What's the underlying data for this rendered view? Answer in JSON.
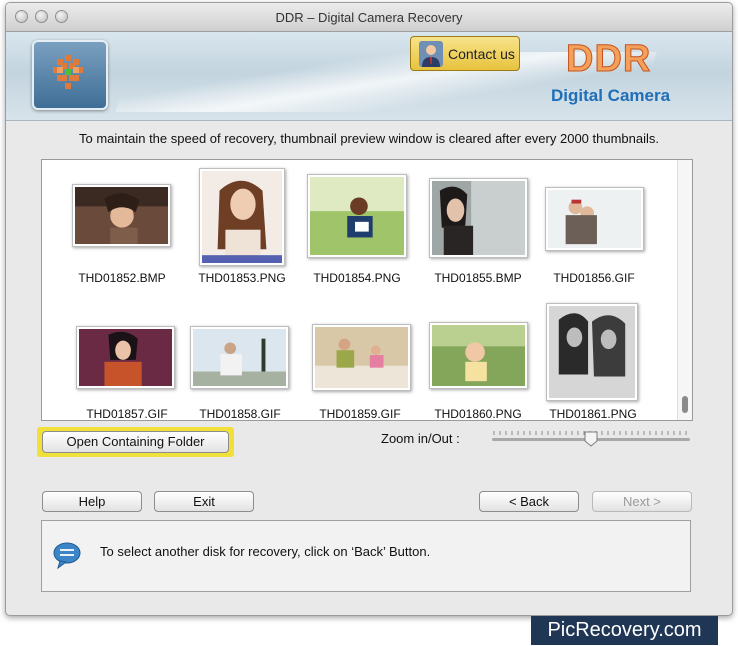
{
  "window": {
    "title": "DDR – Digital Camera Recovery"
  },
  "banner": {
    "contact_label": "Contact us",
    "brand_title": "DDR",
    "brand_subtitle": "Digital Camera",
    "brand_color": "#f5a05a",
    "subtitle_color": "#1f6fb8"
  },
  "info_message": "To maintain the speed of recovery, thumbnail preview window is cleared after every 2000 thumbnails.",
  "thumbnails": [
    {
      "name": "THD01852.BMP",
      "icon": "photo-thumbnail"
    },
    {
      "name": "THD01853.PNG",
      "icon": "photo-thumbnail"
    },
    {
      "name": "THD01854.PNG",
      "icon": "photo-thumbnail"
    },
    {
      "name": "THD01855.BMP",
      "icon": "photo-thumbnail"
    },
    {
      "name": "THD01856.GIF",
      "icon": "photo-thumbnail"
    },
    {
      "name": "THD01857.GIF",
      "icon": "photo-thumbnail"
    },
    {
      "name": "THD01858.GIF",
      "icon": "photo-thumbnail"
    },
    {
      "name": "THD01859.GIF",
      "icon": "photo-thumbnail"
    },
    {
      "name": "THD01860.PNG",
      "icon": "photo-thumbnail"
    },
    {
      "name": "THD01861.PNG",
      "icon": "photo-thumbnail"
    }
  ],
  "controls": {
    "open_folder_label": "Open Containing Folder",
    "open_folder_highlight": "#f1df3a",
    "zoom_label": "Zoom in/Out :",
    "zoom_level_percent": 50
  },
  "buttons": {
    "help": "Help",
    "exit": "Exit",
    "back": "< Back",
    "next": "Next >"
  },
  "status": {
    "message": "To select another disk for recovery, click on ‘Back’ Button.",
    "icon": "speech-bubble-icon"
  },
  "watermark": "PicRecovery.com"
}
